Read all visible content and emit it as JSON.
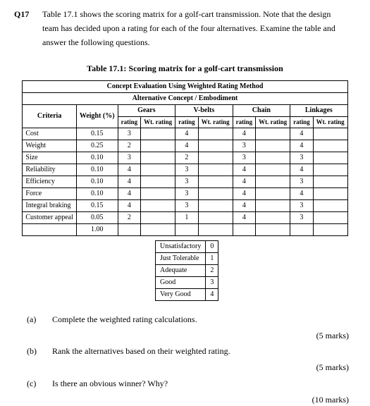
{
  "question": {
    "number": "Q17",
    "text1": "Table 17.1 shows the scoring matrix for a golf-cart transmission. Note that the design",
    "text2": "team has decided upon a rating for each of the four alternatives. Examine the table and",
    "text3": "answer the following questions."
  },
  "table_title": "Table 17.1: Scoring matrix for a golf-cart transmission",
  "chart_data": {
    "type": "table",
    "title": "Concept Evaluation Using Weighted Rating Method",
    "subtitle": "Alternative Concept / Embodiment",
    "alternatives": [
      "Gears",
      "V-belts",
      "Chain",
      "Linkages"
    ],
    "subheaders": [
      "rating",
      "Wt. rating",
      "rating",
      "Wt. rating",
      "rating",
      "Wt. rating",
      "rating",
      "Wt. rating"
    ],
    "criteria_header": "Criteria",
    "weight_header": "Weight (%)",
    "criteria": [
      {
        "name": "Cost",
        "weight": "0.15",
        "gears": "3",
        "vbelts": "4",
        "chain": "4",
        "linkages": "4"
      },
      {
        "name": "Weight",
        "weight": "0.25",
        "gears": "2",
        "vbelts": "4",
        "chain": "3",
        "linkages": "4"
      },
      {
        "name": "Size",
        "weight": "0.10",
        "gears": "3",
        "vbelts": "2",
        "chain": "3",
        "linkages": "3"
      },
      {
        "name": "Reliability",
        "weight": "0.10",
        "gears": "4",
        "vbelts": "3",
        "chain": "4",
        "linkages": "4"
      },
      {
        "name": "Efficiency",
        "weight": "0.10",
        "gears": "4",
        "vbelts": "3",
        "chain": "4",
        "linkages": "3"
      },
      {
        "name": "Force",
        "weight": "0.10",
        "gears": "4",
        "vbelts": "3",
        "chain": "4",
        "linkages": "4"
      },
      {
        "name": "Integral braking",
        "weight": "0.15",
        "gears": "4",
        "vbelts": "3",
        "chain": "4",
        "linkages": "3"
      },
      {
        "name": "Customer appeal",
        "weight": "0.05",
        "gears": "2",
        "vbelts": "1",
        "chain": "4",
        "linkages": "3"
      }
    ],
    "weight_total": "1.00"
  },
  "key": [
    {
      "label": "Unsatisfactory",
      "value": "0"
    },
    {
      "label": "Just Tolerable",
      "value": "1"
    },
    {
      "label": "Adequate",
      "value": "2"
    },
    {
      "label": "Good",
      "value": "3"
    },
    {
      "label": "Very Good",
      "value": "4"
    }
  ],
  "parts": {
    "a": {
      "label": "(a)",
      "text": "Complete the weighted rating calculations.",
      "marks": "(5 marks)"
    },
    "b": {
      "label": "(b)",
      "text": "Rank the alternatives based on their weighted rating.",
      "marks": "(5 marks)"
    },
    "c": {
      "label": "(c)",
      "text": "Is there an obvious winner? Why?",
      "marks": "(10 marks)"
    }
  }
}
